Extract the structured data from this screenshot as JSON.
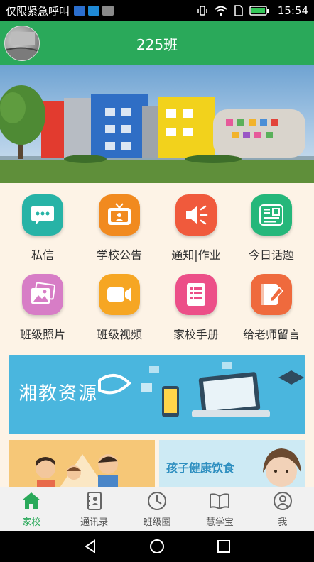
{
  "status_bar": {
    "carrier": "仅限紧急呼叫",
    "time": "15:54"
  },
  "header": {
    "title": "225班"
  },
  "grid": {
    "items": [
      {
        "label": "私信",
        "color": "#27b3a6",
        "icon": "chat-bubble-icon"
      },
      {
        "label": "学校公告",
        "color": "#f18a1f",
        "icon": "tv-announcement-icon"
      },
      {
        "label": "通知|作业",
        "color": "#f05a3c",
        "icon": "speaker-icon"
      },
      {
        "label": "今日话题",
        "color": "#25b77a",
        "icon": "topic-icon"
      },
      {
        "label": "班级照片",
        "color": "#d77dc6",
        "icon": "photo-icon"
      },
      {
        "label": "班级视频",
        "color": "#f6a623",
        "icon": "video-camera-icon"
      },
      {
        "label": "家校手册",
        "color": "#ec4f88",
        "icon": "list-book-icon"
      },
      {
        "label": "给老师留言",
        "color": "#ef6a3d",
        "icon": "notebook-pen-icon"
      }
    ]
  },
  "ads": {
    "xiangjiao": {
      "text": "湘教资源"
    },
    "health": {
      "text": "孩子健康饮食"
    }
  },
  "tabs": [
    {
      "label": "家校",
      "active": true,
      "icon": "home-icon"
    },
    {
      "label": "通讯录",
      "active": false,
      "icon": "address-book-icon"
    },
    {
      "label": "班级圈",
      "active": false,
      "icon": "class-circle-icon"
    },
    {
      "label": "慧学宝",
      "active": false,
      "icon": "open-book-icon"
    },
    {
      "label": "我",
      "active": false,
      "icon": "person-icon"
    }
  ],
  "colors": {
    "primary_green": "#2aa95a",
    "page_background": "#fdf3e6"
  }
}
